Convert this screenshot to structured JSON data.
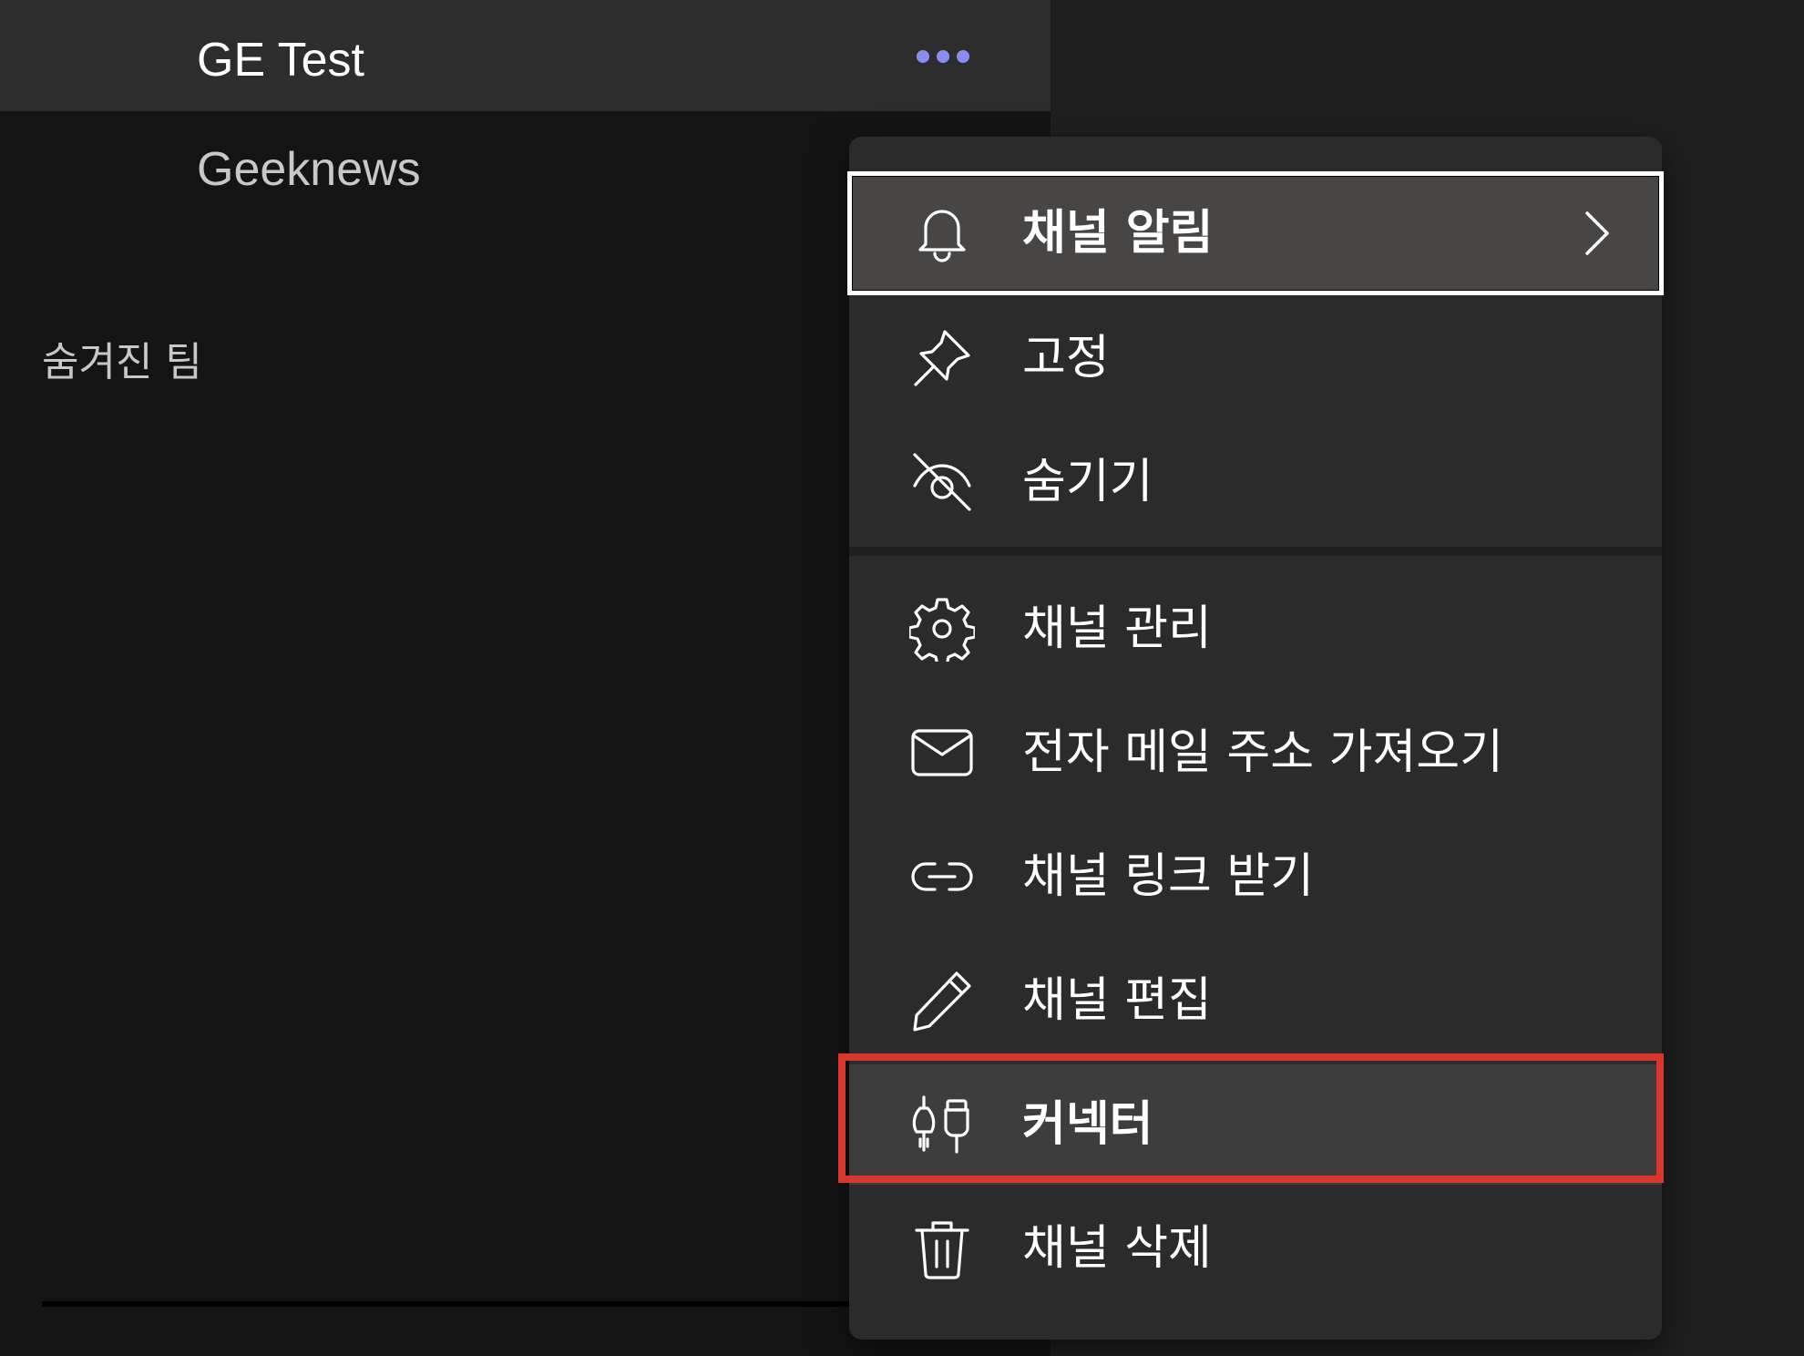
{
  "sidebar": {
    "team_name": "GE Test",
    "channel_name": "Geeknews",
    "hidden_teams_label": "숨겨진 팀"
  },
  "more_options_icon": "more-horizontal-icon",
  "context_menu": {
    "items": [
      {
        "label": "채널 알림",
        "icon": "bell-icon",
        "has_submenu": true,
        "state": "focused"
      },
      {
        "label": "고정",
        "icon": "pin-icon"
      },
      {
        "label": "숨기기",
        "icon": "eye-off-icon"
      },
      {
        "label": "채널 관리",
        "icon": "gear-icon"
      },
      {
        "label": "전자 메일 주소 가져오기",
        "icon": "mail-icon"
      },
      {
        "label": "채널 링크 받기",
        "icon": "link-icon"
      },
      {
        "label": "채널 편집",
        "icon": "pencil-icon"
      },
      {
        "label": "커넥터",
        "icon": "plug-icon",
        "state": "highlighted"
      },
      {
        "label": "채널 삭제",
        "icon": "trash-icon"
      }
    ]
  },
  "colors": {
    "accent_more": "#8b8cf0",
    "annotation_red": "#d9372b",
    "menu_bg": "#2b2b2b"
  }
}
